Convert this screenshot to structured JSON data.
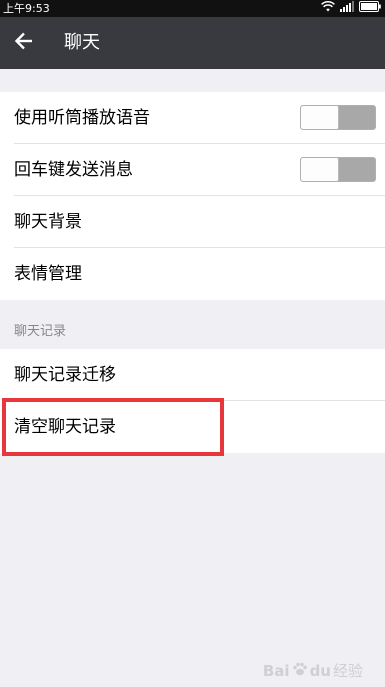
{
  "status_bar": {
    "time": "上午9:53",
    "icons": [
      "wifi-icon",
      "signal-icon",
      "battery-icon"
    ]
  },
  "titlebar": {
    "title": "聊天",
    "back_icon": "back-arrow-icon"
  },
  "settings": {
    "rows": [
      {
        "label": "使用听筒播放语音",
        "toggle": false
      },
      {
        "label": "回车键发送消息",
        "toggle": false
      },
      {
        "label": "聊天背景"
      },
      {
        "label": "表情管理"
      }
    ]
  },
  "history": {
    "header": "聊天记录",
    "rows": [
      {
        "label": "聊天记录迁移"
      },
      {
        "label": "清空聊天记录",
        "highlighted": true
      }
    ]
  },
  "watermark": {
    "brand": "Bai",
    "brand_tail": "du",
    "suffix": "经验"
  },
  "colors": {
    "status_bar": "#111111",
    "titlebar": "#393a3f",
    "background": "#efeff4",
    "highlight": "#e8373c"
  }
}
